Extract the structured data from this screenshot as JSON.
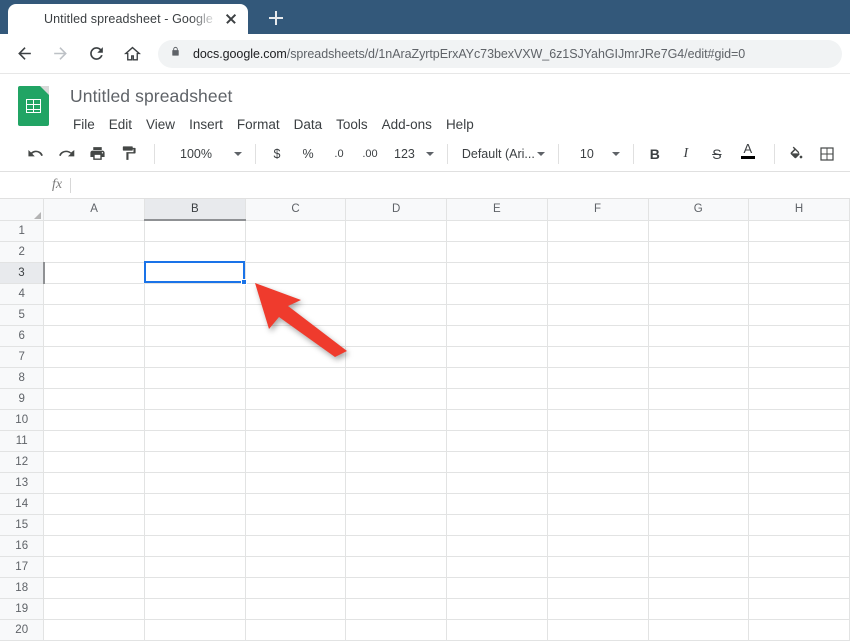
{
  "browser": {
    "tab": {
      "title": "Untitled spreadsheet - Google Sh",
      "favicon": "google-sheets-icon",
      "close_label": "×"
    },
    "new_tab_label": "+",
    "nav": {
      "back": "back-arrow-icon",
      "forward": "forward-arrow-icon",
      "reload": "reload-icon",
      "home": "home-icon"
    },
    "omnibox": {
      "lock": "lock-icon",
      "host": "docs.google.com",
      "path": "/spreadsheets/d/1nAraZyrtpErxAYc73bexVXW_6z1SJYahGIJmrJRe7G4/edit#gid=0",
      "full_url": "docs.google.com/spreadsheets/d/1nAraZyrtpErxAYc73bexVXW_6z1SJYahGIJmrJRe7G4/edit#gid=0"
    }
  },
  "doc": {
    "logo": "google-sheets-logo",
    "title": "Untitled spreadsheet",
    "menu": [
      "File",
      "Edit",
      "View",
      "Insert",
      "Format",
      "Data",
      "Tools",
      "Add-ons",
      "Help"
    ]
  },
  "toolbar": {
    "undo": "undo-icon",
    "redo": "redo-icon",
    "print": "print-icon",
    "paint_format": "paint-format-icon",
    "zoom": "100%",
    "currency": "$",
    "percent": "%",
    "decrease_decimal": ".0",
    "increase_decimal": ".00",
    "more_formats": "123",
    "font": "Default (Ari...",
    "font_size": "10",
    "bold": "B",
    "italic": "I",
    "strikethrough": "S",
    "text_color": "A",
    "fill_color": "fill-color-icon",
    "borders": "borders-icon",
    "merge_cells": "merge-cells-icon",
    "horizontal_align": "horizontal-align-icon"
  },
  "formula_bar": {
    "name_box": "",
    "fx": "fx",
    "value": ""
  },
  "grid": {
    "columns": [
      "A",
      "B",
      "C",
      "D",
      "E",
      "F",
      "G",
      "H"
    ],
    "rows": [
      "1",
      "2",
      "3",
      "4",
      "5",
      "6",
      "7",
      "8",
      "9",
      "10",
      "11",
      "12",
      "13",
      "14",
      "15",
      "16",
      "17",
      "18",
      "19",
      "20"
    ],
    "selected_cell": "B3",
    "selected_column": "B",
    "selected_row": "3",
    "cell_values": {}
  },
  "annotation": {
    "pointer": "red-arrow-pointer",
    "points_at": "B3",
    "color": "#ef3b2d"
  },
  "colors": {
    "tabstrip": "#33587a",
    "accent_blue": "#1a73e8",
    "sheets_green": "#21a464",
    "grid_line": "#e2e3e3",
    "header_bg": "#f8f9fa",
    "header_sel_bg": "#e8eaed"
  }
}
